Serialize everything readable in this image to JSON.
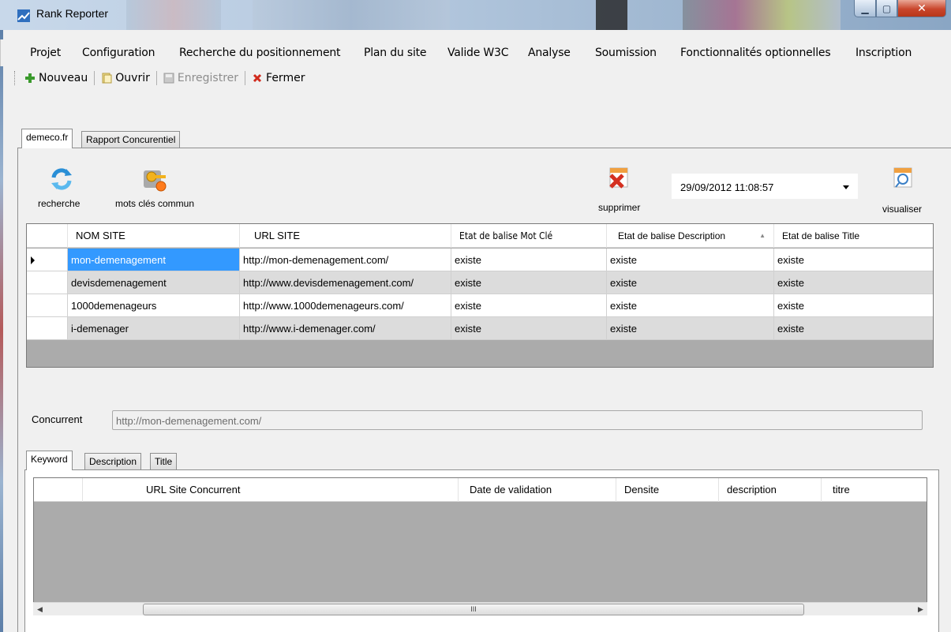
{
  "window": {
    "title": "Rank Reporter",
    "minimize_glyph": "▁",
    "maximize_glyph": "▢",
    "close_glyph": "✕"
  },
  "menu": [
    "Projet",
    "Configuration",
    "Recherche du positionnement",
    "Plan du site",
    "Valide W3C",
    "Analyse",
    "Soumission",
    "Fonctionnalités optionnelles",
    "Inscription"
  ],
  "toolbar": {
    "new_label": "Nouveau",
    "open_label": "Ouvrir",
    "save_label": "Enregistrer",
    "close_label": "Fermer"
  },
  "tabs": [
    "demeco.fr",
    "Rapport Concurentiel"
  ],
  "actions": {
    "search_label": "recherche",
    "keywords_label": "mots clés commun",
    "delete_label": "supprimer",
    "view_label": "visualiser"
  },
  "date_select": {
    "value": "29/09/2012 11:08:57"
  },
  "sites_table": {
    "columns": [
      "NOM SITE",
      "URL SITE",
      "Etat de balise Mot Clé",
      "Etat de balise Description",
      "Etat de balise Title"
    ],
    "sort_glyph": "▲",
    "rows": [
      [
        "mon-demenagement",
        "http://mon-demenagement.com/",
        "existe",
        "existe",
        "existe"
      ],
      [
        "devisdemenagement",
        "http://www.devisdemenagement.com/",
        "existe",
        "existe",
        "existe"
      ],
      [
        "1000demenageurs",
        "http://www.1000demenageurs.com/",
        "existe",
        "existe",
        "existe"
      ],
      [
        "i-demenager",
        "http://www.i-demenager.com/",
        "existe",
        "existe",
        "existe"
      ]
    ]
  },
  "competitor": {
    "label": "Concurrent",
    "value": "http://mon-demenagement.com/"
  },
  "detail_tabs": [
    "Keyword",
    "Description",
    "Title"
  ],
  "detail_table": {
    "columns": [
      "URL Site Concurrent",
      "Date de validation",
      "Densite",
      "description",
      "titre"
    ]
  },
  "scrollbar": {
    "thumb_glyph": "III",
    "left_glyph": "◀",
    "right_glyph": "▶"
  },
  "colors": {
    "selection": "#3399ff",
    "grid_bg": "#ababab",
    "alt_row": "#dcdcdc"
  }
}
